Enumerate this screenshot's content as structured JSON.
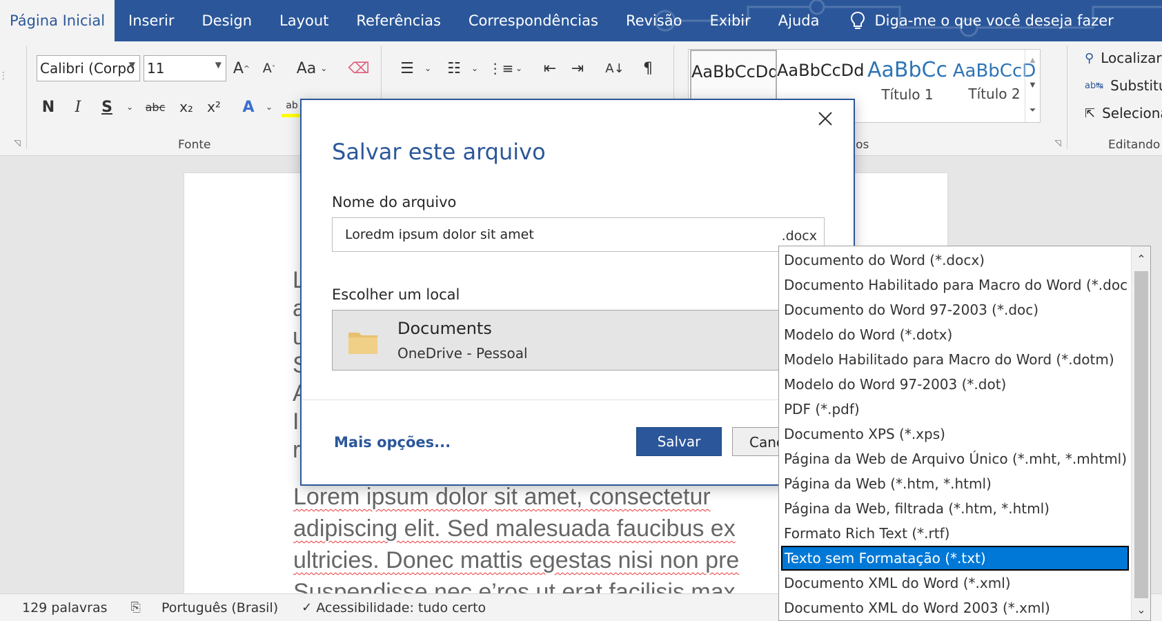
{
  "tabs": [
    "Página Inicial",
    "Inserir",
    "Design",
    "Layout",
    "Referências",
    "Correspondências",
    "Revisão",
    "Exibir",
    "Ajuda"
  ],
  "tell_me": "Diga-me o que você deseja fazer",
  "ribbon": {
    "font_name": "Calibri (Corpo",
    "font_size": "11",
    "group_font": "Fonte",
    "group_styles": "tilos",
    "group_editing": "Editando",
    "styles": [
      {
        "sample": "AaBbCcDd",
        "name": ""
      },
      {
        "sample": "AaBbCcDd",
        "name": ""
      },
      {
        "sample": "AaBbCc",
        "name": "Título 1"
      },
      {
        "sample": "AaBbCcD",
        "name": "Título 2"
      }
    ],
    "editing": [
      "Localizar",
      "Substituir",
      "Seleciona"
    ],
    "format_buttons": [
      "N",
      "I",
      "S",
      "abc",
      "x₂",
      "x²",
      "A",
      "Aa",
      "¶"
    ]
  },
  "document": {
    "left_chars": [
      "L",
      "a",
      "u",
      "S",
      "A",
      "I",
      "r"
    ],
    "lines": [
      "Lorem ipsum dolor sit amet, consectetur",
      "adipiscing elit. Sed malesuada faucibus ex",
      "ultricies. Donec mattis egestas nisi non pre",
      "Suspendisse nec e’ros ut erat facilisis max"
    ]
  },
  "status": {
    "words": "129 palavras",
    "language": "Português (Brasil)",
    "accessibility": "Acessibilidade: tudo certo"
  },
  "dialog": {
    "title": "Salvar este arquivo",
    "filename_label": "Nome do arquivo",
    "filename_value": "Loredm ipsum dolor sit amet",
    "extension": ".docx",
    "location_label": "Escolher um local",
    "location_name": "Documents",
    "location_sub": "OneDrive - Pessoal",
    "more_options": "Mais opções...",
    "save": "Salvar",
    "cancel": "Cancelar"
  },
  "file_types": [
    "Documento do Word (*.docx)",
    "Documento Habilitado para Macro do Word (*.docm)",
    "Documento do Word 97-2003 (*.doc)",
    "Modelo do Word (*.dotx)",
    "Modelo Habilitado para Macro do Word (*.dotm)",
    "Modelo do Word 97-2003 (*.dot)",
    "PDF (*.pdf)",
    "Documento XPS (*.xps)",
    "Página da Web de Arquivo Único (*.mht, *.mhtml)",
    "Página da Web (*.htm, *.html)",
    "Página da Web, filtrada (*.htm, *.html)",
    "Formato Rich Text (*.rtf)",
    "Texto sem Formatação (*.txt)",
    "Documento XML do Word (*.xml)",
    "Documento XML do Word 2003 (*.xml)"
  ],
  "selected_file_type": "Texto sem Formatação (*.txt)",
  "colors": {
    "accent": "#2b579a",
    "selection": "#0078d7"
  }
}
